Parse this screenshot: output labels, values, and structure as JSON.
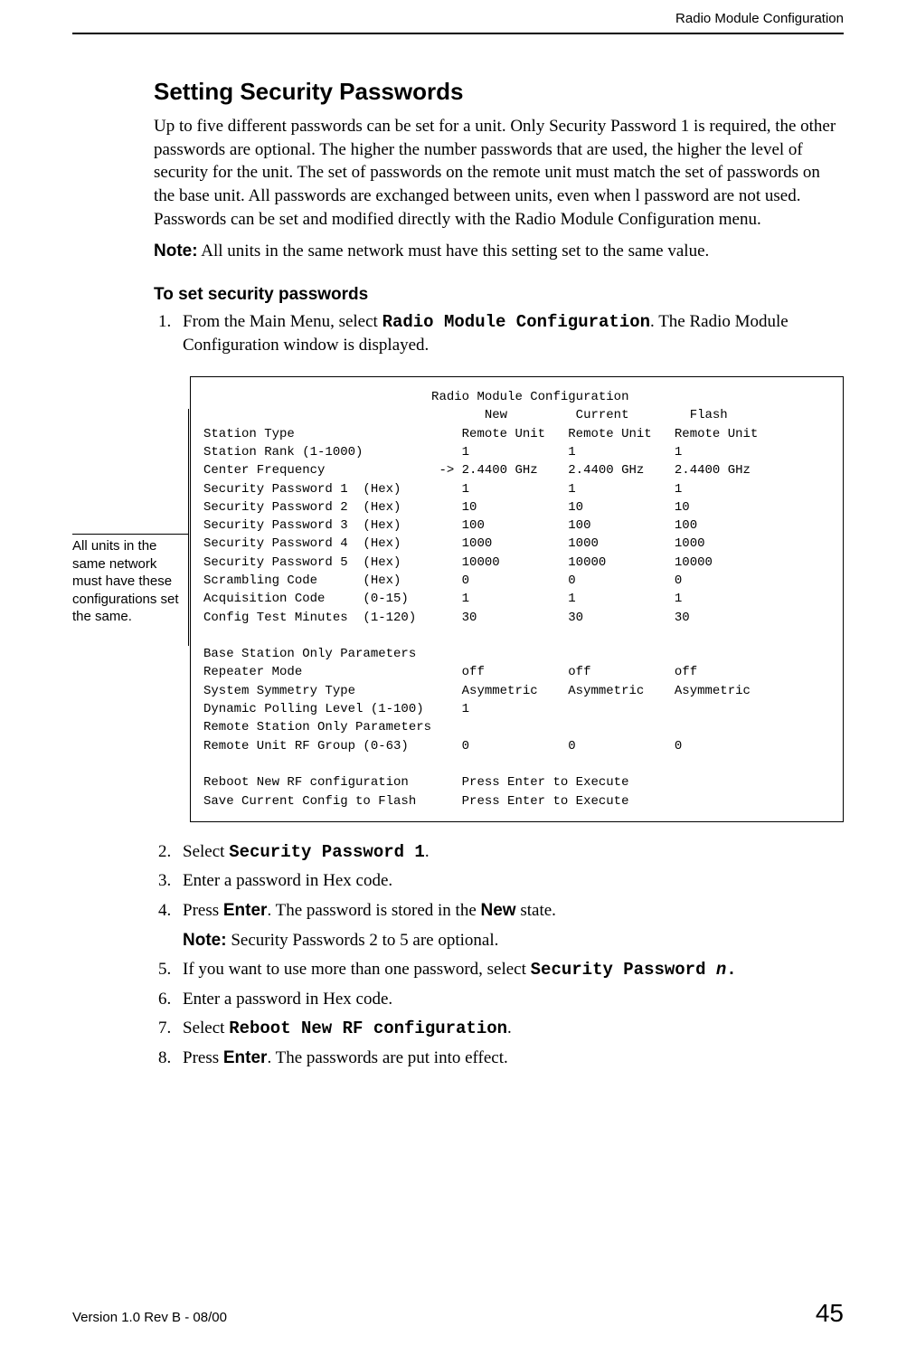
{
  "header": "Radio Module Configuration",
  "section_title": "Setting Security Passwords",
  "intro_para": "Up to five different passwords can be set for a unit. Only Security Password 1 is required, the other passwords are optional. The higher the number passwords that are used, the higher the level of security for the unit. The set of passwords on the remote unit must match the set of passwords on the base unit. All passwords are exchanged between units, even when l password are not used. Passwords can be set and modified directly with the Radio Module Configuration menu.",
  "note_label": "Note:",
  "note_text": " All units in the same network must have this setting set to the same value.",
  "subheading": "To set security passwords",
  "step1_a": "From the Main Menu, select ",
  "step1_b": "Radio Module Configuration",
  "step1_c": ". The Radio Module Configuration window is displayed.",
  "sidebar_note": "All units in the same network must have these configurations set the same.",
  "terminal": "                              Radio Module Configuration\n                                     New         Current        Flash\nStation Type                      Remote Unit   Remote Unit   Remote Unit\nStation Rank (1-1000)             1             1             1\nCenter Frequency               -> 2.4400 GHz    2.4400 GHz    2.4400 GHz\nSecurity Password 1  (Hex)        1             1             1\nSecurity Password 2  (Hex)        10            10            10\nSecurity Password 3  (Hex)        100           100           100\nSecurity Password 4  (Hex)        1000          1000          1000\nSecurity Password 5  (Hex)        10000         10000         10000\nScrambling Code      (Hex)        0             0             0\nAcquisition Code     (0-15)       1             1             1\nConfig Test Minutes  (1-120)      30            30            30\n\nBase Station Only Parameters\nRepeater Mode                     off           off           off\nSystem Symmetry Type              Asymmetric    Asymmetric    Asymmetric\nDynamic Polling Level (1-100)     1\nRemote Station Only Parameters\nRemote Unit RF Group (0-63)       0             0             0\n\nReboot New RF configuration       Press Enter to Execute\nSave Current Config to Flash      Press Enter to Execute",
  "step2_a": "Select ",
  "step2_b": "Security Password 1",
  "step2_c": ".",
  "step3": "Enter a password in Hex code.",
  "step4_a": "Press ",
  "step4_b": "Enter",
  "step4_c": ". The password is stored in the ",
  "step4_d": "New",
  "step4_e": " state.",
  "step4_note_label": "Note:",
  "step4_note_text": " Security Passwords 2 to 5 are optional.",
  "step5_a": "If you want to use more than one password, select ",
  "step5_b": "Security Password ",
  "step5_c": "n",
  "step5_d": ".",
  "step6": "Enter a password in Hex code.",
  "step7_a": "Select ",
  "step7_b": "Reboot New RF configuration",
  "step7_c": ".",
  "step8_a": "Press ",
  "step8_b": "Enter",
  "step8_c": ". The passwords are put into effect.",
  "footer_left": "Version 1.0 Rev B - 08/00",
  "footer_right": "45"
}
